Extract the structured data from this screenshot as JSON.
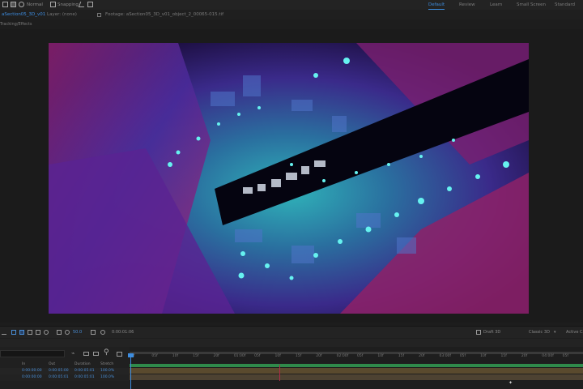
{
  "toolbar": {
    "normal_label": "Normal",
    "snapping_label": "Snapping",
    "workspaces": [
      "Default",
      "Review",
      "Learn",
      "Small Screen",
      "Standard"
    ],
    "active_workspace": "Default"
  },
  "panels": {
    "comp_tab": "aSection05_3D_v01",
    "layer_tab": "Layer: (none)",
    "footage_tab": "Footage: aSection05_3D_v01_object_2_00065-015.tif",
    "effects_label": "Tracking/Effects"
  },
  "viewer": {
    "zoom": "50.0",
    "timecode": "0:00:01:06",
    "renderer_label": "Draft 3D",
    "renderer_mode": "Classic 3D",
    "camera_label": "Active Ca"
  },
  "timeline": {
    "columns": [
      "In",
      "Out",
      "Duration",
      "Stretch"
    ],
    "rows": [
      {
        "in": "0:00:00:00",
        "out": "0:00:05:00",
        "duration": "0:00:05:01",
        "stretch": "100.0%"
      },
      {
        "in": "0:00:00:00",
        "out": "0:00:05:01",
        "duration": "0:00:05:01",
        "stretch": "100.0%"
      }
    ],
    "ruler_ticks": [
      "0f",
      "05f",
      "10f",
      "15f",
      "20f",
      "01:00f",
      "05f",
      "10f",
      "15f",
      "20f",
      "02:00f",
      "05f",
      "10f",
      "15f",
      "20f",
      "03:00f",
      "05f",
      "10f",
      "15f",
      "20f",
      "04:00f",
      "05f"
    ]
  },
  "colors": {
    "accent": "#3d8de0",
    "track_bar": "#5a4a2e",
    "green_bar": "#2f8a4a"
  }
}
